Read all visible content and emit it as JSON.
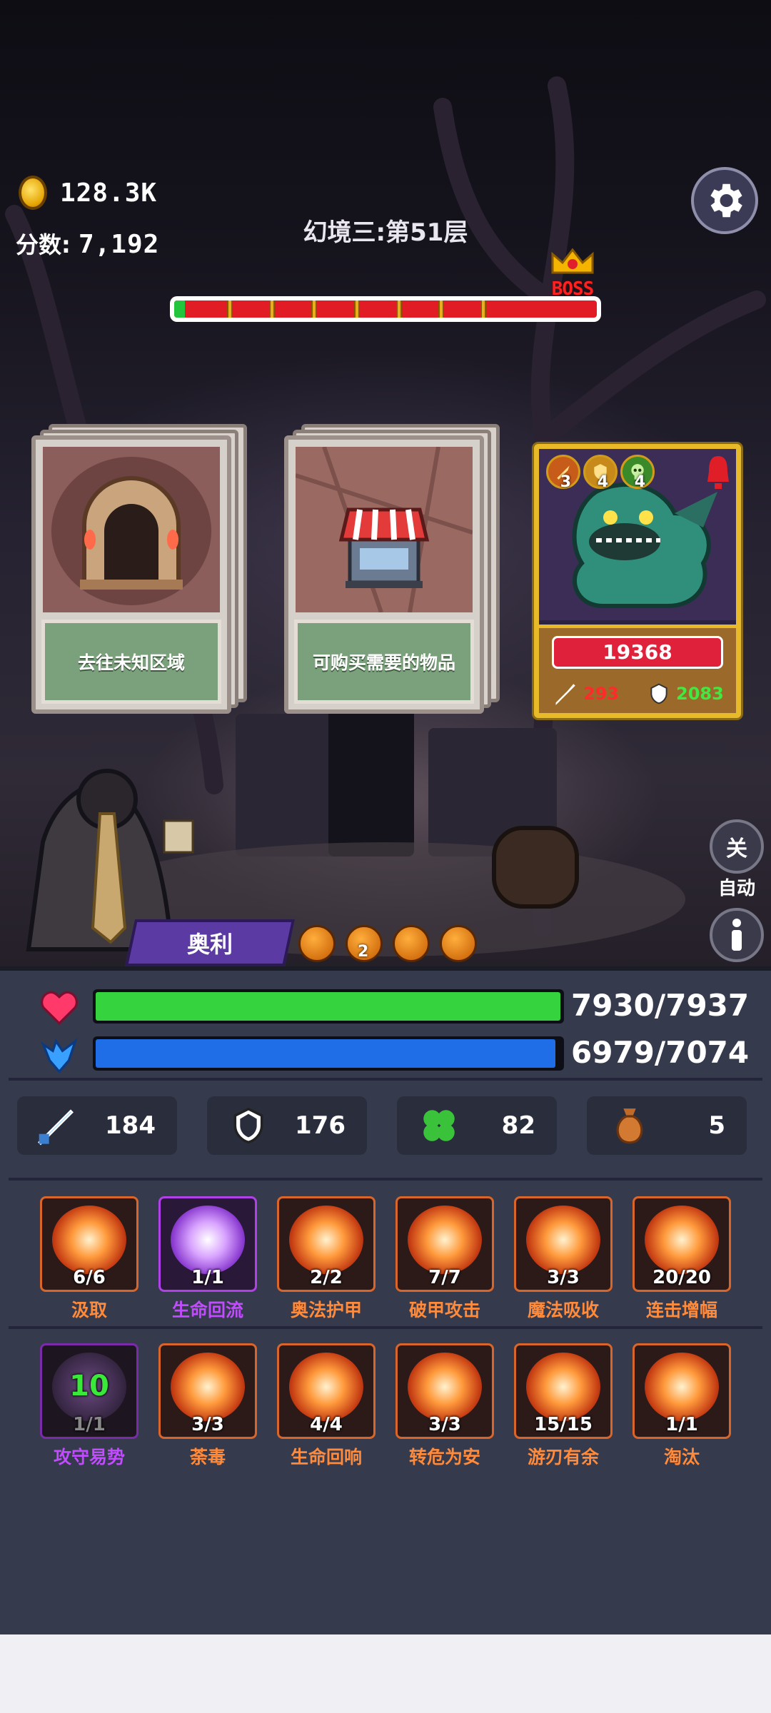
{
  "hud": {
    "gold": "128.3K",
    "score_label": "分数:",
    "score_value": "7,192",
    "level_title": "幻境三:第51层",
    "boss_label": "BOSS",
    "progress_fraction": 0.025
  },
  "cards": [
    {
      "label": "去往未知区域",
      "art": "dungeon-gate"
    },
    {
      "label": "可购买需要的物品",
      "art": "shop-stall"
    }
  ],
  "boss_card": {
    "hp": "19368",
    "attack": "293",
    "defense": "2083",
    "badges": [
      {
        "icon": "sword-badge-icon",
        "count": "3"
      },
      {
        "icon": "shield-badge-icon",
        "count": "4"
      },
      {
        "icon": "skull-badge-icon",
        "count": "4"
      }
    ]
  },
  "side": {
    "toggle_label": "关",
    "auto_label": "自动"
  },
  "hero": {
    "name": "奥利",
    "buff_stack": "2"
  },
  "stats": {
    "hp": "7930/7937",
    "hp_fraction": 0.999,
    "mp": "6979/7074",
    "mp_fraction": 0.987,
    "attack": "184",
    "defense": "176",
    "luck": "82",
    "bag": "5"
  },
  "skills_row1": [
    {
      "name": "汲取",
      "count": "6/6",
      "style": "orange"
    },
    {
      "name": "生命回流",
      "count": "1/1",
      "style": "purple"
    },
    {
      "name": "奥法护甲",
      "count": "2/2",
      "style": "orange"
    },
    {
      "name": "破甲攻击",
      "count": "7/7",
      "style": "orange"
    },
    {
      "name": "魔法吸收",
      "count": "3/3",
      "style": "orange"
    },
    {
      "name": "连击增幅",
      "count": "20/20",
      "style": "orange"
    }
  ],
  "skills_row2": [
    {
      "name": "攻守易势",
      "count": "1/1",
      "style": "dark",
      "level": "10"
    },
    {
      "name": "荼毒",
      "count": "3/3",
      "style": "orange"
    },
    {
      "name": "生命回响",
      "count": "4/4",
      "style": "orange"
    },
    {
      "name": "转危为安",
      "count": "3/3",
      "style": "orange"
    },
    {
      "name": "游刃有余",
      "count": "15/15",
      "style": "orange"
    },
    {
      "name": "淘汰",
      "count": "1/1",
      "style": "orange"
    }
  ],
  "colors": {
    "hp_bar": "#35d43f",
    "mp_bar": "#1f6ee8",
    "skill_name": "#ff8a3a",
    "skill_name_special": "#c24bff"
  }
}
